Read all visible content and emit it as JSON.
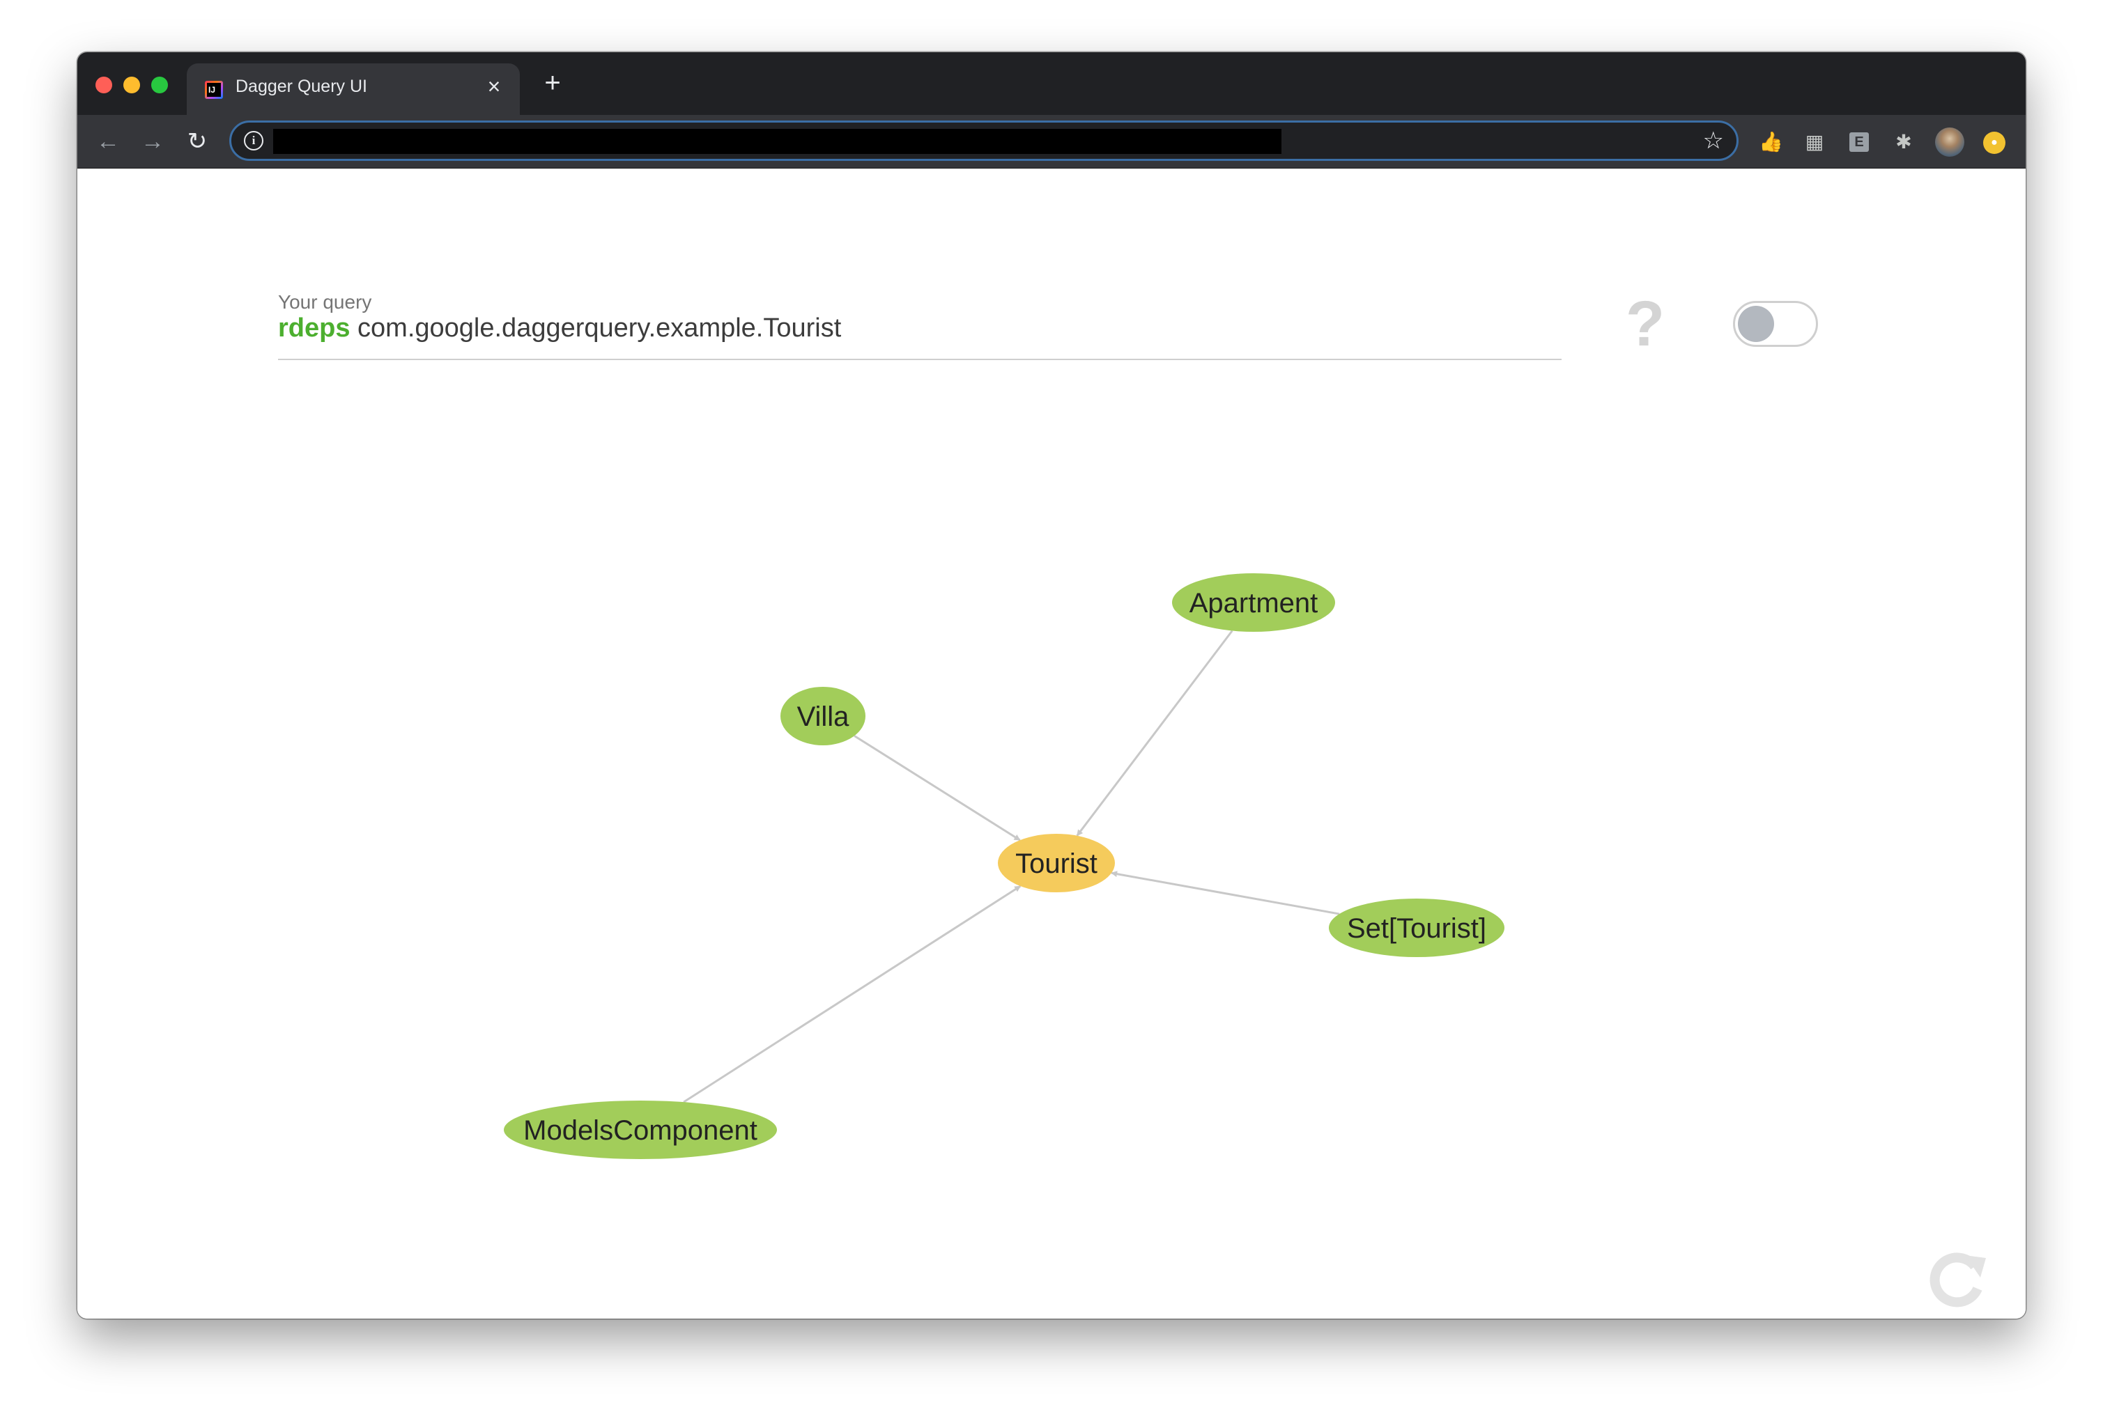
{
  "browser": {
    "tab_title": "Dagger Query UI",
    "tab_close": "×",
    "new_tab": "+",
    "url": "",
    "nav": {
      "back": "←",
      "forward": "→",
      "reload": "↻"
    },
    "omnibox_info": "i",
    "bookmark_star": "☆",
    "extensions": [
      {
        "name": "thumbs-up-extension",
        "glyph": "👍"
      },
      {
        "name": "qr-code-extension",
        "glyph": "▦"
      },
      {
        "name": "e-extension",
        "glyph": "E"
      },
      {
        "name": "puzzle-extension",
        "glyph": "✱"
      }
    ]
  },
  "query": {
    "label": "Your query",
    "keyword": "rdeps",
    "target": " com.google.daggerquery.example.Tourist"
  },
  "help_glyph": "?",
  "toggle": {
    "checked": false
  },
  "graph": {
    "nodes": [
      {
        "id": "apartment",
        "label": "Apartment",
        "role": "dependent"
      },
      {
        "id": "villa",
        "label": "Villa",
        "role": "dependent"
      },
      {
        "id": "tourist",
        "label": "Tourist",
        "role": "target"
      },
      {
        "id": "set-tourist",
        "label": "Set[Tourist]",
        "role": "dependent"
      },
      {
        "id": "models-component",
        "label": "ModelsComponent",
        "role": "dependent"
      }
    ],
    "edges": [
      {
        "from": "apartment",
        "to": "tourist"
      },
      {
        "from": "villa",
        "to": "tourist"
      },
      {
        "from": "set-tourist",
        "to": "tourist"
      },
      {
        "from": "models-component",
        "to": "tourist"
      }
    ],
    "colors": {
      "dependent": "#a2cd5a",
      "target": "#f5cb5c",
      "edge": "#c8c8c8"
    }
  },
  "colors": {
    "keyword": "#4caf2f",
    "tabbar": "#202124",
    "toolbar": "#35363a",
    "omnibox_border": "#3b6ea5"
  }
}
